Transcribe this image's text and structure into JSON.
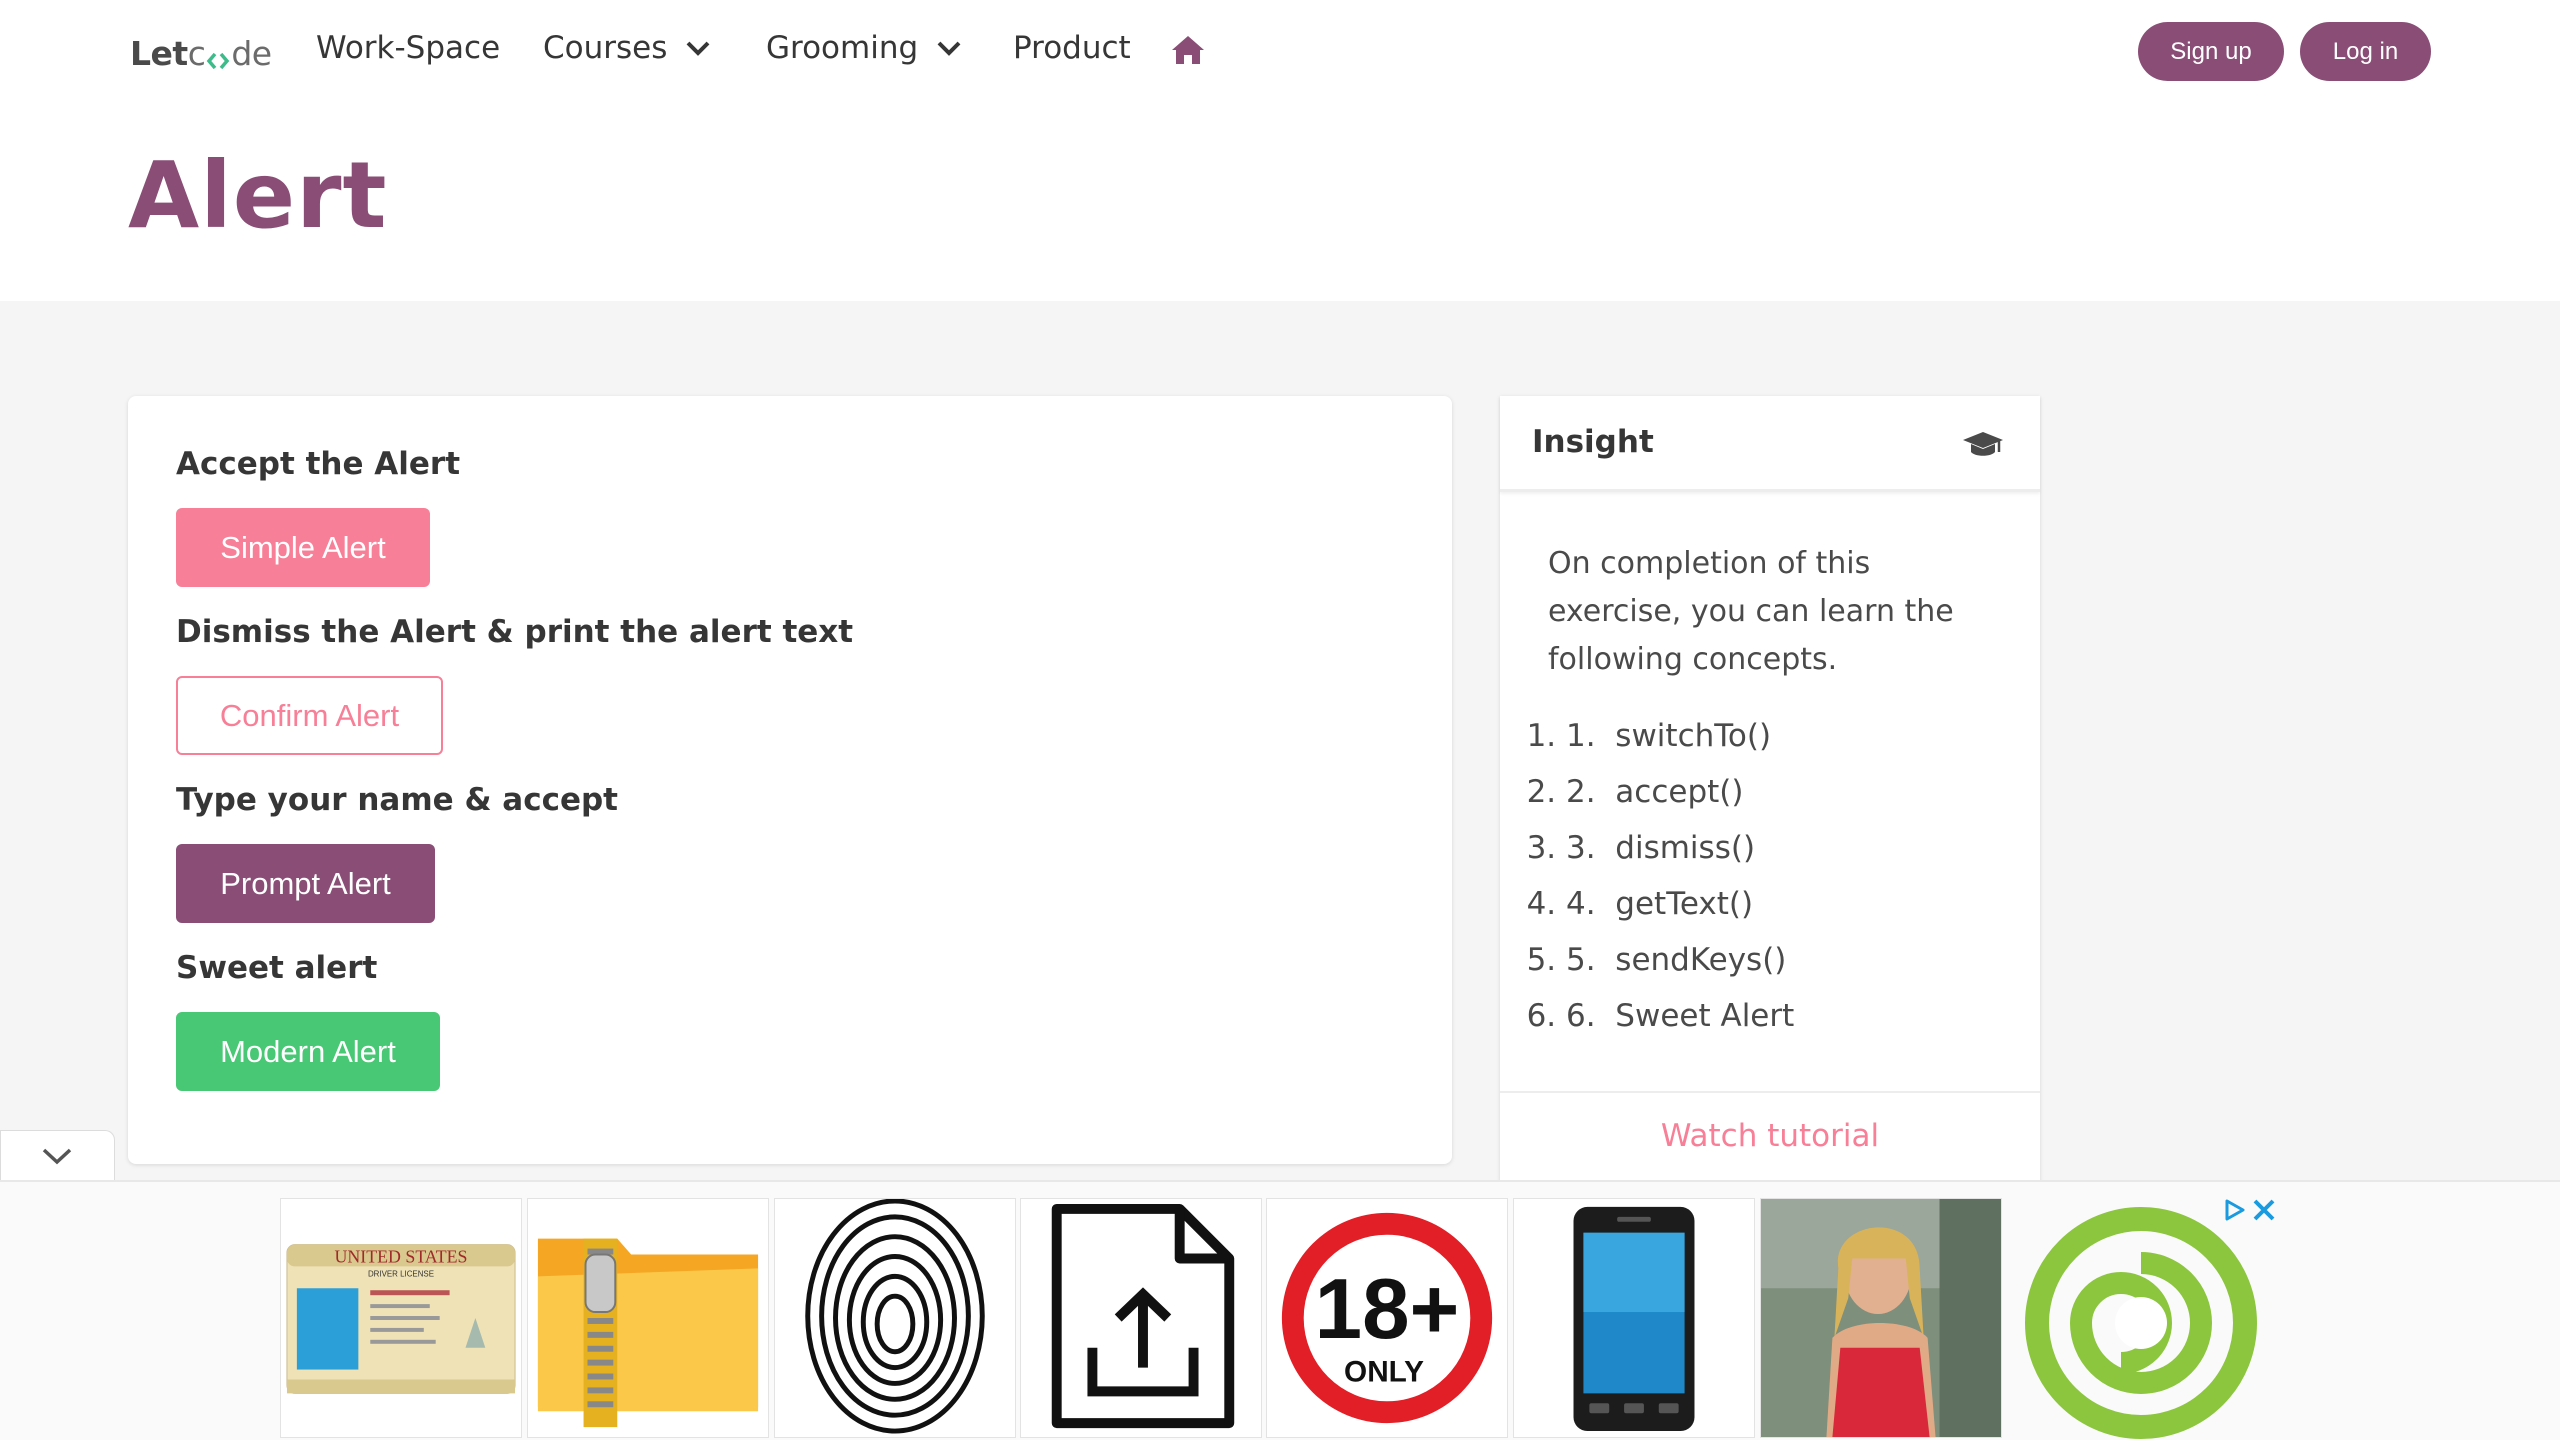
{
  "brand": {
    "let": "Let",
    "code": "de"
  },
  "nav": {
    "items": [
      "Work-Space",
      "Courses",
      "Grooming",
      "Product"
    ],
    "signup": "Sign up",
    "login": "Log in"
  },
  "page": {
    "title": "Alert"
  },
  "sections": [
    {
      "label": "Accept the Alert",
      "button": "Simple Alert"
    },
    {
      "label": "Dismiss the Alert & print the alert text",
      "button": "Confirm Alert"
    },
    {
      "label": "Type your name & accept",
      "button": "Prompt Alert"
    },
    {
      "label": "Sweet alert",
      "button": "Modern Alert"
    }
  ],
  "insight": {
    "title": "Insight",
    "description": "On completion of this exercise, you can learn the following concepts.",
    "concepts": [
      "switchTo()",
      "accept()",
      "dismiss()",
      "getText()",
      "sendKeys()",
      "Sweet Alert"
    ],
    "watch": "Watch tutorial"
  },
  "ad": {
    "tiles": [
      "driver-license",
      "zip-folder",
      "fingerprint",
      "file-upload",
      "18-plus-only",
      "smartphone",
      "woman-photo"
    ],
    "license_text": "UNITED STATES",
    "license_sub": "DRIVER LICENSE",
    "badge_number": "18+",
    "badge_text": "ONLY"
  },
  "colors": {
    "brand": "#8a4d76",
    "pink": "#f77f97",
    "green": "#48c774",
    "ad_green": "#8cc63f"
  }
}
